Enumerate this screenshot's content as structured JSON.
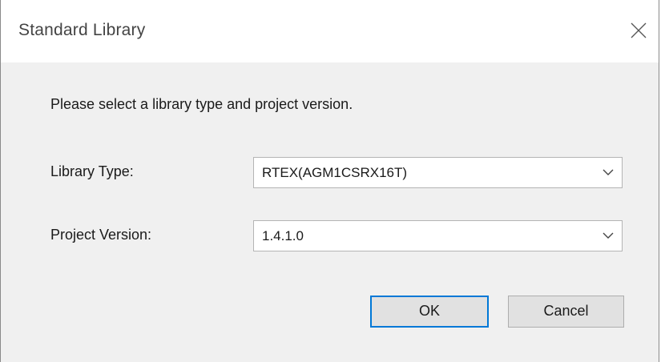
{
  "window": {
    "title": "Standard Library",
    "close_icon": "close-icon"
  },
  "dialog": {
    "prompt": "Please select a library type and project version.",
    "library_type": {
      "label": "Library Type:",
      "selected": "RTEX(AGM1CSRX16T)"
    },
    "project_version": {
      "label": "Project Version:",
      "selected": "1.4.1.0"
    }
  },
  "buttons": {
    "ok": "OK",
    "cancel": "Cancel"
  },
  "colors": {
    "focus_border": "#0078d7",
    "dialog_bg": "#f0f0f0",
    "titlebar_bg": "#ffffff"
  }
}
